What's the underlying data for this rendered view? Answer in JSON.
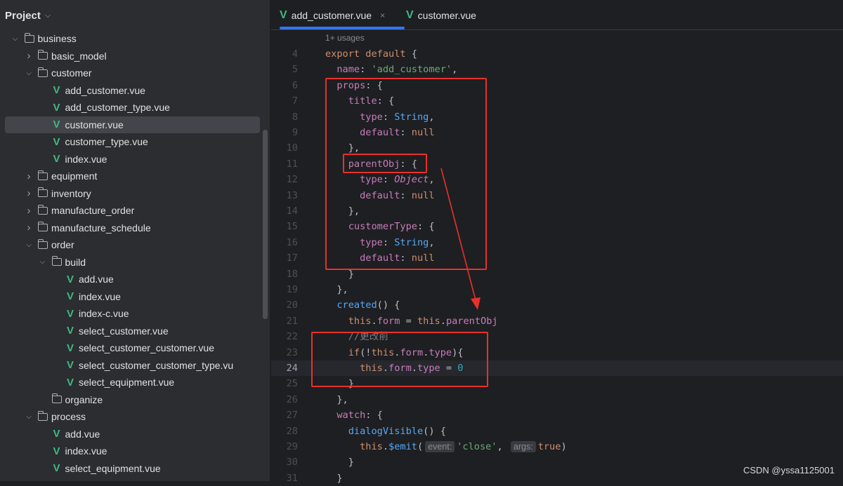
{
  "sidebar": {
    "title": "Project",
    "tree": [
      {
        "label": "business",
        "kind": "folder",
        "level": 3,
        "expanded": true
      },
      {
        "label": "basic_model",
        "kind": "folder",
        "level": 4,
        "expanded": false
      },
      {
        "label": "customer",
        "kind": "folder",
        "level": 4,
        "expanded": true
      },
      {
        "label": "add_customer.vue",
        "kind": "vue",
        "level": 5
      },
      {
        "label": "add_customer_type.vue",
        "kind": "vue",
        "level": 5
      },
      {
        "label": "customer.vue",
        "kind": "vue",
        "level": 5,
        "selected": true
      },
      {
        "label": "customer_type.vue",
        "kind": "vue",
        "level": 5
      },
      {
        "label": "index.vue",
        "kind": "vue",
        "level": 5
      },
      {
        "label": "equipment",
        "kind": "folder",
        "level": 4,
        "expanded": false
      },
      {
        "label": "inventory",
        "kind": "folder",
        "level": 4,
        "expanded": false
      },
      {
        "label": "manufacture_order",
        "kind": "folder",
        "level": 4,
        "expanded": false
      },
      {
        "label": "manufacture_schedule",
        "kind": "folder",
        "level": 4,
        "expanded": false
      },
      {
        "label": "order",
        "kind": "folder",
        "level": 4,
        "expanded": true
      },
      {
        "label": "build",
        "kind": "folder",
        "level": 5,
        "expanded": true
      },
      {
        "label": "add.vue",
        "kind": "vue",
        "level": 6
      },
      {
        "label": "index.vue",
        "kind": "vue",
        "level": 6
      },
      {
        "label": "index-c.vue",
        "kind": "vue",
        "level": 6
      },
      {
        "label": "select_customer.vue",
        "kind": "vue",
        "level": 6
      },
      {
        "label": "select_customer_customer.vue",
        "kind": "vue",
        "level": 6
      },
      {
        "label": "select_customer_customer_type.vu",
        "kind": "vue",
        "level": 6
      },
      {
        "label": "select_equipment.vue",
        "kind": "vue",
        "level": 6
      },
      {
        "label": "organize",
        "kind": "folder",
        "level": 5,
        "leaf": true
      },
      {
        "label": "process",
        "kind": "folder",
        "level": 4,
        "expanded": true
      },
      {
        "label": "add.vue",
        "kind": "vue",
        "level": 5
      },
      {
        "label": "index.vue",
        "kind": "vue",
        "level": 5
      },
      {
        "label": "select_equipment.vue",
        "kind": "vue",
        "level": 5
      }
    ]
  },
  "tabs": [
    {
      "label": "add_customer.vue",
      "active": true,
      "close": "×"
    },
    {
      "label": "customer.vue",
      "active": false
    }
  ],
  "editor": {
    "usages": "1+ usages",
    "current_line": 24,
    "lines": [
      {
        "n": "4",
        "t": [
          [
            "kw",
            "export default "
          ],
          [
            "",
            "{"
          ]
        ]
      },
      {
        "n": "5",
        "t": [
          [
            "",
            "  "
          ],
          [
            "pr",
            "name"
          ],
          [
            "",
            ": "
          ],
          [
            "st",
            "'add_customer'"
          ],
          [
            "",
            ","
          ]
        ]
      },
      {
        "n": "6",
        "t": [
          [
            "",
            "  "
          ],
          [
            "pr",
            "props"
          ],
          [
            "",
            ": {"
          ]
        ]
      },
      {
        "n": "7",
        "t": [
          [
            "",
            "    "
          ],
          [
            "pr",
            "title"
          ],
          [
            "",
            ": {"
          ]
        ]
      },
      {
        "n": "8",
        "t": [
          [
            "",
            "      "
          ],
          [
            "pr",
            "type"
          ],
          [
            "",
            ": "
          ],
          [
            "ty",
            "String"
          ],
          [
            "",
            ","
          ]
        ]
      },
      {
        "n": "9",
        "t": [
          [
            "",
            "      "
          ],
          [
            "pr",
            "default"
          ],
          [
            "",
            ": "
          ],
          [
            "kw",
            "null"
          ]
        ]
      },
      {
        "n": "10",
        "t": [
          [
            "",
            "    },"
          ]
        ]
      },
      {
        "n": "11",
        "t": [
          [
            "",
            "    "
          ],
          [
            "pr",
            "parentObj"
          ],
          [
            "",
            ": {"
          ]
        ]
      },
      {
        "n": "12",
        "t": [
          [
            "",
            "      "
          ],
          [
            "pr",
            "type"
          ],
          [
            "",
            ": "
          ],
          [
            "it",
            "Object"
          ],
          [
            "",
            ","
          ]
        ]
      },
      {
        "n": "13",
        "t": [
          [
            "",
            "      "
          ],
          [
            "pr",
            "default"
          ],
          [
            "",
            ": "
          ],
          [
            "kw",
            "null"
          ]
        ]
      },
      {
        "n": "14",
        "t": [
          [
            "",
            "    },"
          ]
        ]
      },
      {
        "n": "15",
        "t": [
          [
            "",
            "    "
          ],
          [
            "pr",
            "customerType"
          ],
          [
            "",
            ": {"
          ]
        ]
      },
      {
        "n": "16",
        "t": [
          [
            "",
            "      "
          ],
          [
            "pr",
            "type"
          ],
          [
            "",
            ": "
          ],
          [
            "ty",
            "String"
          ],
          [
            "",
            ","
          ]
        ]
      },
      {
        "n": "17",
        "t": [
          [
            "",
            "      "
          ],
          [
            "pr",
            "default"
          ],
          [
            "",
            ": "
          ],
          [
            "kw",
            "null"
          ]
        ]
      },
      {
        "n": "18",
        "t": [
          [
            "",
            "    }"
          ]
        ]
      },
      {
        "n": "19",
        "t": [
          [
            "",
            "  },"
          ]
        ]
      },
      {
        "n": "20",
        "t": [
          [
            "",
            "  "
          ],
          [
            "fn",
            "created"
          ],
          [
            "",
            "() {"
          ]
        ]
      },
      {
        "n": "21",
        "t": [
          [
            "",
            "    "
          ],
          [
            "kw",
            "this"
          ],
          [
            "",
            "."
          ],
          [
            "pr",
            "form"
          ],
          [
            "",
            " = "
          ],
          [
            "kw",
            "this"
          ],
          [
            "",
            "."
          ],
          [
            "pr",
            "parentObj"
          ]
        ]
      },
      {
        "n": "22",
        "t": [
          [
            "",
            "    "
          ],
          [
            "cm",
            "//更改前"
          ]
        ]
      },
      {
        "n": "23",
        "t": [
          [
            "",
            "    "
          ],
          [
            "kw",
            "if"
          ],
          [
            "",
            "(!"
          ],
          [
            "kw",
            "this"
          ],
          [
            "",
            "."
          ],
          [
            "pr",
            "form"
          ],
          [
            "",
            "."
          ],
          [
            "pr",
            "type"
          ],
          [
            "",
            "){"
          ]
        ]
      },
      {
        "n": "24",
        "t": [
          [
            "",
            "      "
          ],
          [
            "kw",
            "this"
          ],
          [
            "",
            "."
          ],
          [
            "pr",
            "form"
          ],
          [
            "",
            "."
          ],
          [
            "pr",
            "type"
          ],
          [
            "",
            " = "
          ],
          [
            "nu",
            "0"
          ]
        ]
      },
      {
        "n": "25",
        "t": [
          [
            "",
            "    }"
          ]
        ]
      },
      {
        "n": "26",
        "t": [
          [
            "",
            "  },"
          ]
        ]
      },
      {
        "n": "27",
        "t": [
          [
            "",
            "  "
          ],
          [
            "pr",
            "watch"
          ],
          [
            "",
            ": {"
          ]
        ]
      },
      {
        "n": "28",
        "t": [
          [
            "",
            "    "
          ],
          [
            "fn",
            "dialogVisible"
          ],
          [
            "",
            "() {"
          ]
        ]
      },
      {
        "n": "29",
        "t": [
          [
            "",
            "      "
          ],
          [
            "kw",
            "this"
          ],
          [
            "",
            "."
          ],
          [
            "fn",
            "$emit"
          ],
          [
            "",
            "("
          ],
          [
            "hint",
            "event:"
          ],
          [
            "st",
            "'close'"
          ],
          [
            "",
            ", "
          ],
          [
            "hint",
            "args:"
          ],
          [
            "kw",
            "true"
          ],
          [
            "",
            ")"
          ]
        ]
      },
      {
        "n": "30",
        "t": [
          [
            "",
            "    }"
          ]
        ]
      },
      {
        "n": "31",
        "t": [
          [
            "",
            "  }"
          ]
        ]
      }
    ]
  },
  "watermark": "CSDN @yssa1125001",
  "colors": {
    "annotation": "#e8312a",
    "accent": "#3574f0",
    "vue": "#41b883"
  }
}
